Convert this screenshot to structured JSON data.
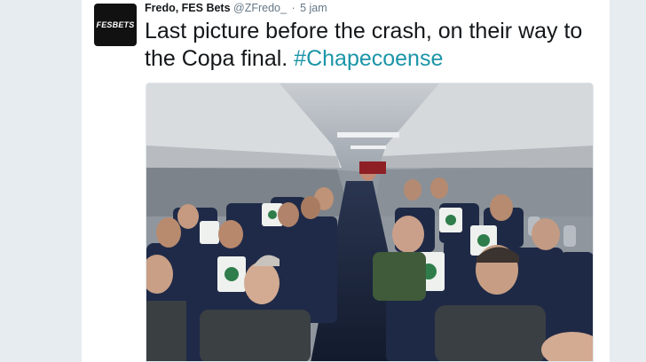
{
  "tweet": {
    "avatar_label": "FESBETS",
    "author_name": "Fredo, FES Bets",
    "author_handle": "@ZFredo_",
    "separator": "·",
    "timestamp": "5 jam",
    "text_main": "Last picture before the crash, on their way to the Copa final.",
    "hashtag": "#Chapecoense"
  },
  "colors": {
    "page_background": "#e6ecf0",
    "card_background": "#ffffff",
    "hashtag": "#1b95a8",
    "text": "#14171a",
    "muted": "#657786"
  },
  "media": {
    "icon": "photo-image",
    "subject": "airplane cabin interior with seated passengers"
  }
}
